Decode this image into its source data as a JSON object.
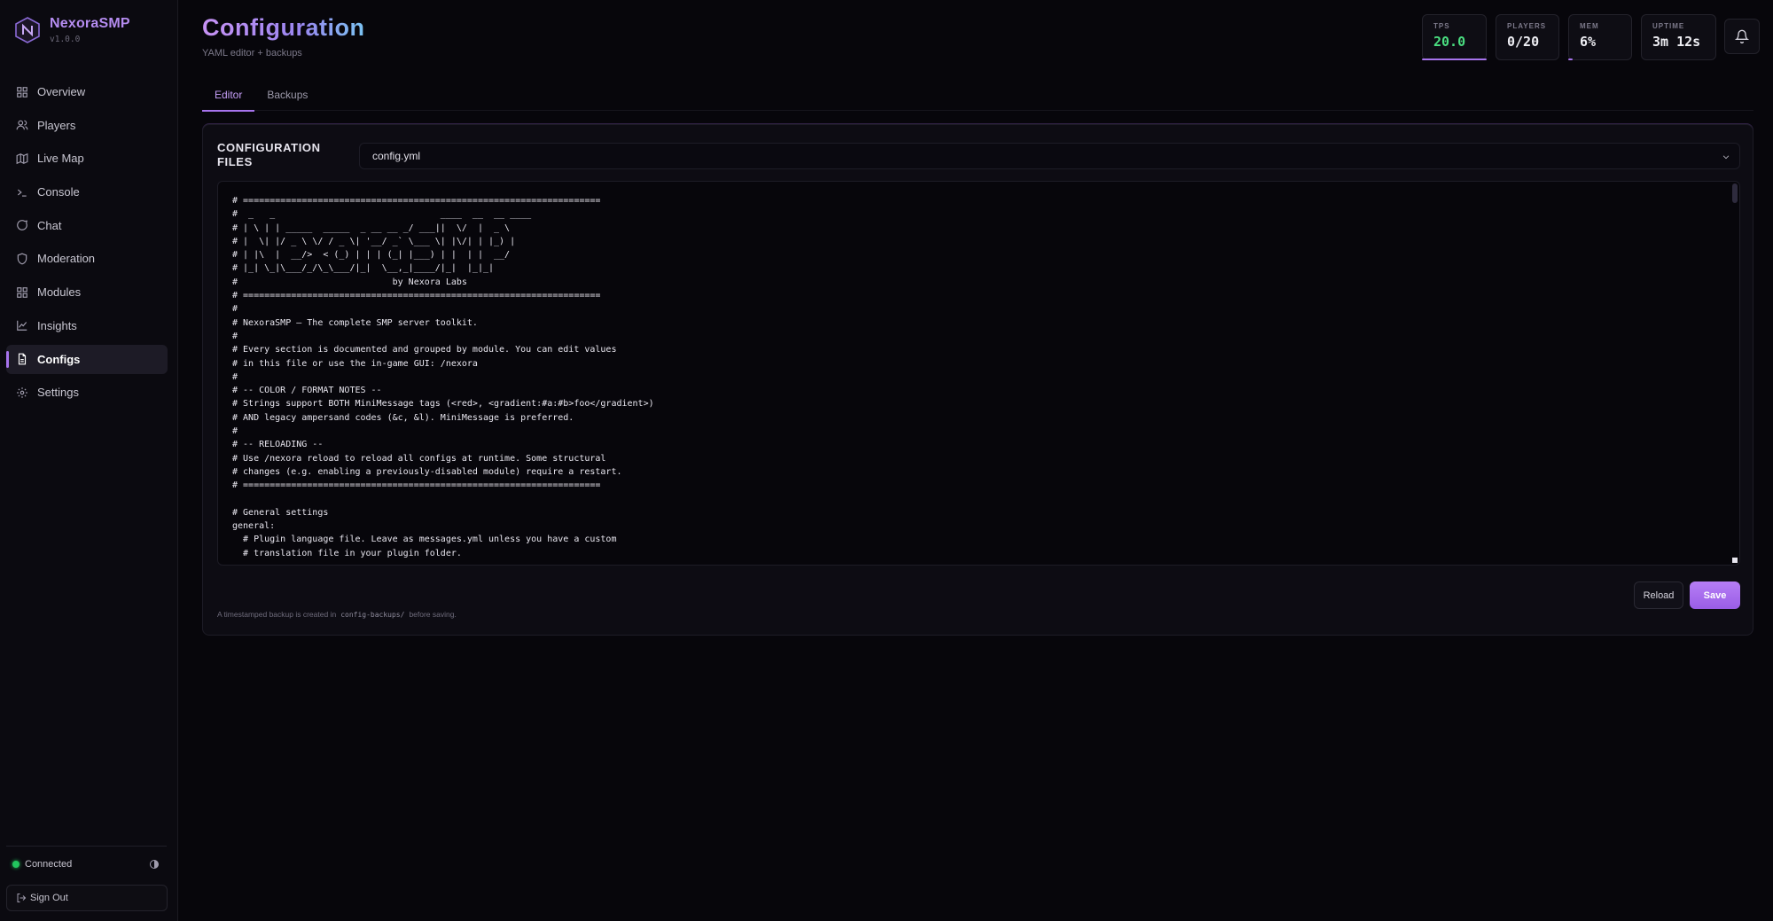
{
  "app": {
    "name": "NexoraSMP",
    "version": "v1.0.0"
  },
  "sidebar": {
    "items": [
      {
        "label": "Overview",
        "icon": "grid-icon"
      },
      {
        "label": "Players",
        "icon": "users-icon"
      },
      {
        "label": "Live Map",
        "icon": "map-icon"
      },
      {
        "label": "Console",
        "icon": "terminal-icon"
      },
      {
        "label": "Chat",
        "icon": "chat-icon"
      },
      {
        "label": "Moderation",
        "icon": "shield-icon"
      },
      {
        "label": "Modules",
        "icon": "grid-icon"
      },
      {
        "label": "Insights",
        "icon": "chart-icon"
      },
      {
        "label": "Configs",
        "icon": "file-icon",
        "active": true
      },
      {
        "label": "Settings",
        "icon": "gear-icon"
      }
    ],
    "status": "Connected",
    "sign_out": "Sign Out"
  },
  "header": {
    "title": "Configuration",
    "subtitle": "YAML editor + backups"
  },
  "stats": [
    {
      "label": "TPS",
      "value": "20.0"
    },
    {
      "label": "PLAYERS",
      "value": "0/20"
    },
    {
      "label": "MEM",
      "value": "6%"
    },
    {
      "label": "UPTIME",
      "value": "3m 12s"
    }
  ],
  "tabs": [
    {
      "label": "Editor",
      "active": true
    },
    {
      "label": "Backups",
      "active": false
    }
  ],
  "editor": {
    "section_label": "CONFIGURATION FILES",
    "selected_file": "config.yml",
    "content": "# ===================================================================\n#  _   _                               ____  __  __ ____\n# | \\ | | _____  _____  _ __ __ _/ ___||  \\/  |  _ \\\n# |  \\| |/ _ \\ \\/ / _ \\| '__/ _` \\___ \\| |\\/| | |_) |\n# | |\\  |  __/>  < (_) | | | (_| |___) | |  | |  __/\n# |_| \\_|\\___/_/\\_\\___/|_|  \\__,_|____/|_|  |_|_|\n#                             by Nexora Labs\n# ===================================================================\n#\n# NexoraSMP — The complete SMP server toolkit.\n#\n# Every section is documented and grouped by module. You can edit values\n# in this file or use the in-game GUI: /nexora\n#\n# -- COLOR / FORMAT NOTES --\n# Strings support BOTH MiniMessage tags (<red>, <gradient:#a:#b>foo</gradient>)\n# AND legacy ampersand codes (&c, &l). MiniMessage is preferred.\n#\n# -- RELOADING --\n# Use /nexora reload to reload all configs at runtime. Some structural\n# changes (e.g. enabling a previously-disabled module) require a restart.\n# ===================================================================\n\n# General settings\ngeneral:\n  # Plugin language file. Leave as messages.yml unless you have a custom\n  # translation file in your plugin folder.",
    "reload_label": "Reload",
    "save_label": "Save",
    "footnote_before": "A timestamped backup is created in",
    "footnote_code": "config-backups/",
    "footnote_after": "before saving."
  },
  "colors": {
    "accent": "#a673ec",
    "success": "#22c55e",
    "background": "#07060b"
  }
}
